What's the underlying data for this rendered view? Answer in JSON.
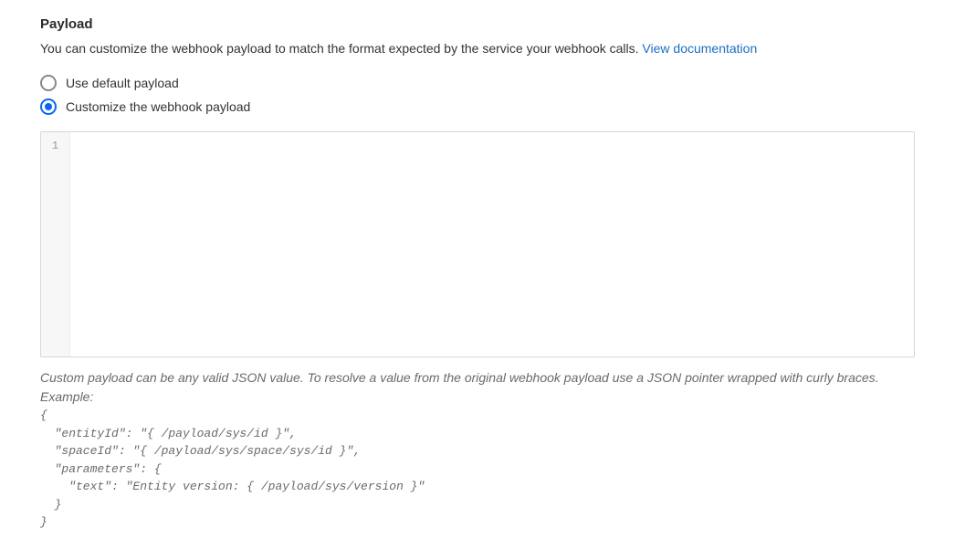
{
  "section": {
    "title": "Payload",
    "description": "You can customize the webhook payload to match the format expected by the service your webhook calls. ",
    "doc_link": "View documentation"
  },
  "radios": {
    "default_label": "Use default payload",
    "custom_label": "Customize the webhook payload",
    "selected": "custom"
  },
  "editor": {
    "line_number": "1",
    "content": ""
  },
  "help": {
    "intro": "Custom payload can be any valid JSON value. To resolve a value from the original webhook payload use a JSON pointer wrapped with curly braces. Example:",
    "example": "{\n  \"entityId\": \"{ /payload/sys/id }\",\n  \"spaceId\": \"{ /payload/sys/space/sys/id }\",\n  \"parameters\": {\n    \"text\": \"Entity version: { /payload/sys/version }\"\n  }\n}"
  }
}
